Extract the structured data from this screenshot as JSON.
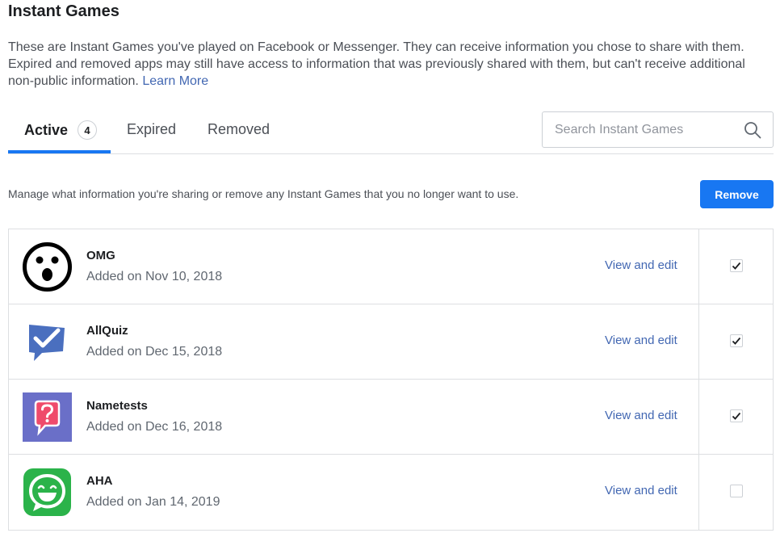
{
  "page": {
    "title": "Instant Games",
    "description": "These are Instant Games you've played on Facebook or Messenger. They can receive information you chose to share with them. Expired and removed apps may still have access to information that was previously shared with them, but can't receive additional non-public information.",
    "learn_more": "Learn More"
  },
  "tabs": [
    {
      "label": "Active",
      "count": "4",
      "active": true
    },
    {
      "label": "Expired",
      "active": false
    },
    {
      "label": "Removed",
      "active": false
    }
  ],
  "search": {
    "placeholder": "Search Instant Games",
    "icon": "search-icon"
  },
  "manage_text": "Manage what information you're sharing or remove any Instant Games that you no longer want to use.",
  "remove_button": "Remove",
  "accent_color": "#1877f2",
  "games": [
    {
      "name": "OMG",
      "added": "Added on Nov 10, 2018",
      "action": "View and edit",
      "checked": true,
      "icon": "omg-surprised-face-icon"
    },
    {
      "name": "AllQuiz",
      "added": "Added on Dec 15, 2018",
      "action": "View and edit",
      "checked": true,
      "icon": "allquiz-checkmark-icon"
    },
    {
      "name": "Nametests",
      "added": "Added on Dec 16, 2018",
      "action": "View and edit",
      "checked": true,
      "icon": "nametests-question-icon"
    },
    {
      "name": "AHA",
      "added": "Added on Jan 14, 2019",
      "action": "View and edit",
      "checked": false,
      "icon": "aha-smile-icon"
    }
  ]
}
